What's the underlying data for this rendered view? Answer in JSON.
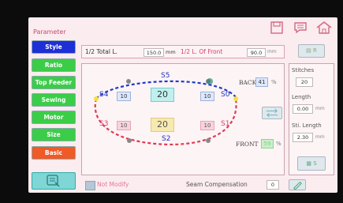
{
  "header": {
    "title": "Parameter"
  },
  "sidebar": {
    "items": [
      {
        "label": "Style",
        "color": "blue"
      },
      {
        "label": "Ratio",
        "color": "green"
      },
      {
        "label": "Top Feeder",
        "color": "green"
      },
      {
        "label": "Sewing",
        "color": "green"
      },
      {
        "label": "Motor",
        "color": "green"
      },
      {
        "label": "Size",
        "color": "green"
      },
      {
        "label": "Basic",
        "color": "orange"
      }
    ]
  },
  "top_row": {
    "total_label": "1/2 Total L.",
    "total_value": "150.0",
    "total_unit": "mm",
    "front_label": "1/2 L. Of  Front",
    "front_value": "90.0",
    "front_unit": "mm",
    "r_button": "R"
  },
  "diagram": {
    "s5": "S5",
    "s4": "S4",
    "s0": "S0",
    "s3": "S3",
    "s1": "S1",
    "s2": "S2",
    "top_left": "10",
    "top_center": "20",
    "top_right": "10",
    "bottom_left": "10",
    "bottom_center": "20",
    "bottom_right": "10",
    "back_label": "BACK",
    "back_value": "41",
    "back_unit": "%",
    "front_label": "FRONT",
    "front_value": "59",
    "front_unit": "%"
  },
  "right_panel": {
    "stitches_label": "Stitches",
    "stitches_value": "20",
    "length_label": "Length",
    "length_value": "0.00",
    "length_unit": "mm",
    "sti_length_label": "Sti. Length",
    "sti_length_value": "2.30",
    "sti_length_unit": "mm",
    "s_button": "S"
  },
  "bottom": {
    "not_modify_label": "Not Modify",
    "seam_label": "Seam Compensation",
    "seam_value": "0"
  },
  "colors": {
    "accent": "#d84064",
    "blue_dash": "#1f3cc4",
    "red_dash": "#e03a52"
  }
}
